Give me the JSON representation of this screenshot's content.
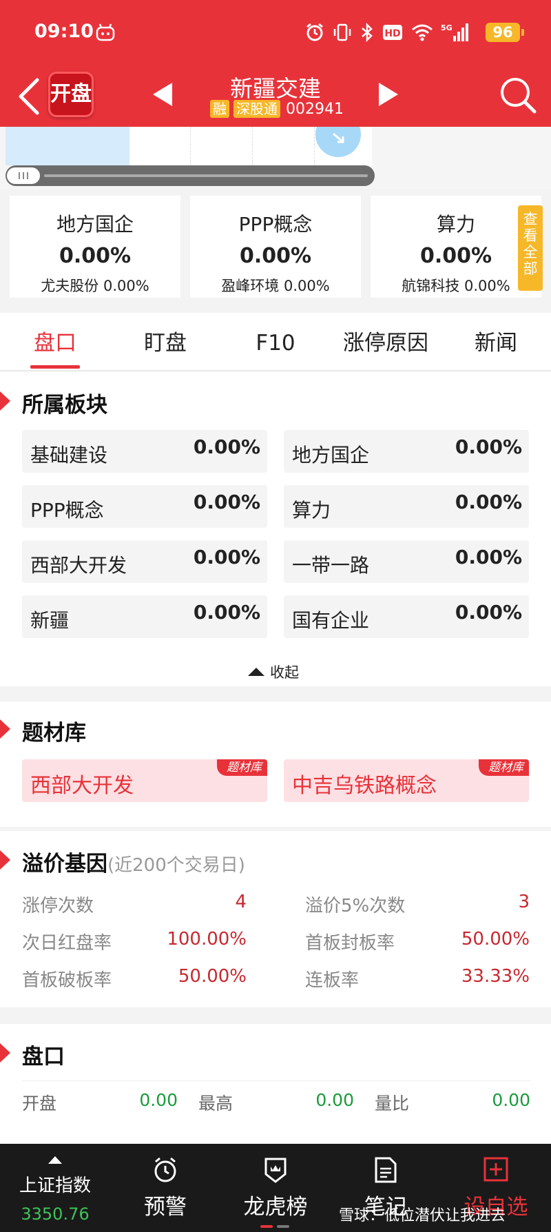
{
  "status_bar": {
    "time": "09:10",
    "network": "5G",
    "battery": "96"
  },
  "header": {
    "app_logo": "开盘",
    "stock_name": "新疆交建",
    "tags": [
      "融",
      "深股通"
    ],
    "stock_code": "002941"
  },
  "concepts": {
    "cards": [
      {
        "title": "地方国企",
        "change": "0.00%",
        "leader": "尤夫股份 0.00%"
      },
      {
        "title": "PPP概念",
        "change": "0.00%",
        "leader": "盈峰环境 0.00%"
      },
      {
        "title": "算力",
        "change": "0.00%",
        "leader": "航锦科技 0.00%"
      }
    ],
    "view_all": "查看全部"
  },
  "tabs": [
    {
      "label": "盘口",
      "active": true
    },
    {
      "label": "盯盘"
    },
    {
      "label": "F10"
    },
    {
      "label": "涨停原因"
    },
    {
      "label": "新闻"
    }
  ],
  "sector_section": {
    "title": "所属板块",
    "items": [
      {
        "name": "基础建设",
        "change": "0.00%"
      },
      {
        "name": "地方国企",
        "change": "0.00%"
      },
      {
        "name": "PPP概念",
        "change": "0.00%"
      },
      {
        "name": "算力",
        "change": "0.00%"
      },
      {
        "name": "西部大开发",
        "change": "0.00%"
      },
      {
        "name": "一带一路",
        "change": "0.00%"
      },
      {
        "name": "新疆",
        "change": "0.00%"
      },
      {
        "name": "国有企业",
        "change": "0.00%"
      }
    ],
    "collapse": "收起"
  },
  "theme_section": {
    "title": "题材库",
    "items": [
      {
        "name": "西部大开发",
        "badge": "题材库"
      },
      {
        "name": "中吉乌铁路概念",
        "badge": "题材库"
      }
    ]
  },
  "premium_section": {
    "title": "溢价基因",
    "subtitle": "(近200个交易日)",
    "items": [
      {
        "label": "涨停次数",
        "value": "4"
      },
      {
        "label": "溢价5%次数",
        "value": "3"
      },
      {
        "label": "次日红盘率",
        "value": "100.00%"
      },
      {
        "label": "首板封板率",
        "value": "50.00%"
      },
      {
        "label": "首板破板率",
        "value": "50.00%"
      },
      {
        "label": "连板率",
        "value": "33.33%"
      }
    ]
  },
  "pankou_section": {
    "title": "盘口",
    "items": [
      {
        "label": "开盘",
        "value": "0.00"
      },
      {
        "label": "最高",
        "value": "0.00"
      },
      {
        "label": "量比",
        "value": "0.00"
      }
    ]
  },
  "bottom_nav": {
    "index_name": "上证指数",
    "index_value": "3350.76",
    "items": [
      "预警",
      "龙虎榜",
      "笔记",
      "设自选"
    ],
    "watermark": "雪球：低位潜伏让我进去"
  },
  "colors": {
    "brand_red": "#e8323a",
    "tag_orange": "#f6b728",
    "rise_red": "#c8282f",
    "flat_green": "#1a9b3a"
  }
}
